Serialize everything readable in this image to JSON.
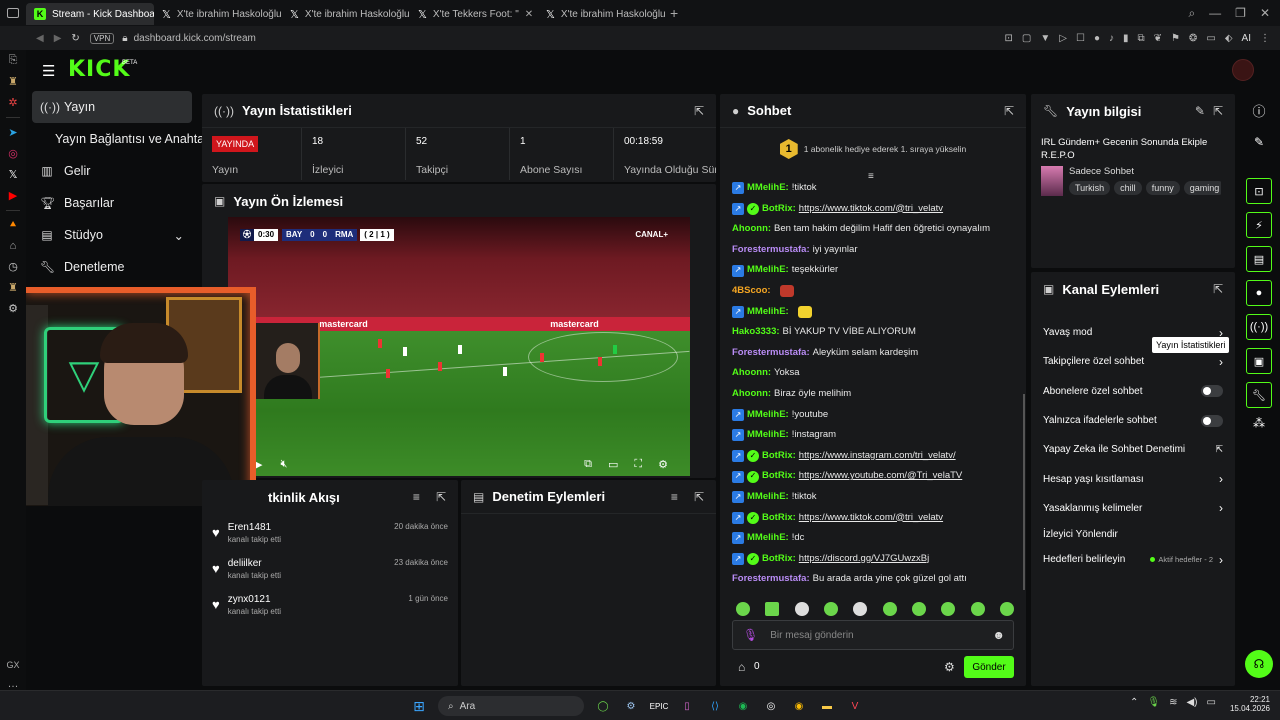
{
  "browser": {
    "tabs": [
      {
        "title": "Stream - Kick Dashboard"
      },
      {
        "title": "X'te ibrahim Haskoloğlu: \""
      },
      {
        "title": "X'te ibrahim Haskoloğlu: \""
      },
      {
        "title": "X'te Tekkers Foot: \""
      },
      {
        "title": "X'te ibrahim Haskoloğlu: \""
      }
    ],
    "vpn": "VPN",
    "url": "dashboard.kick.com/stream",
    "ai_label": "AI"
  },
  "header": {
    "logo": "KICK",
    "beta": "BETA"
  },
  "nav": {
    "items": [
      {
        "label": "Yayın",
        "icon": "live-icon"
      },
      {
        "label": "Yayın Bağlantısı ve Anahtarı",
        "icon": ""
      },
      {
        "label": "Gelir",
        "icon": "chart-icon"
      },
      {
        "label": "Başarılar",
        "icon": "trophy-icon"
      },
      {
        "label": "Stüdyo",
        "icon": "studio-icon"
      },
      {
        "label": "Denetleme",
        "icon": "wrench-icon"
      }
    ]
  },
  "stats_panel": {
    "title": "Yayın İstatistikleri",
    "live_badge": "YAYINDA",
    "stats": [
      {
        "value": "",
        "label": "Yayın"
      },
      {
        "value": "18",
        "label": "İzleyici"
      },
      {
        "value": "52",
        "label": "Takipçi"
      },
      {
        "value": "1",
        "label": "Abone Sayısı"
      },
      {
        "value": "00:18:59",
        "label": "Yayında Olduğu Süre"
      }
    ]
  },
  "preview": {
    "title": "Yayın Ön İzlemesi",
    "scoreboard": {
      "time": "0:30",
      "home": "BAY",
      "home_score": "0",
      "away_score": "0",
      "away": "RMA",
      "agg": "( 2 | 1 )"
    },
    "broadcaster": "CANAL+",
    "ad_text": "mastercard"
  },
  "activity": {
    "title": "Etkinlik Akışı",
    "title_visible": "tkinlik Akışı",
    "items": [
      {
        "name": "Eren1481",
        "action": "kanalı takip etti",
        "time": "20 dakika önce"
      },
      {
        "name": "deliilker",
        "action": "kanalı takip etti",
        "time": "23 dakika önce"
      },
      {
        "name": "zynx0121",
        "action": "kanalı takip etti",
        "time": "1 gün önce"
      }
    ]
  },
  "moderation": {
    "title": "Denetim Eylemleri"
  },
  "chat": {
    "title": "Sohbet",
    "gift_rank": "1",
    "gift_text": "1 abonelik hediye ederek 1. sıraya yükselin",
    "messages": [
      {
        "user": "MMelihE:",
        "text": "!tiktok",
        "color": "#53fc18",
        "badge": true,
        "verified": false,
        "link": false
      },
      {
        "user": "BotRix:",
        "text": "https://www.tiktok.com/@tri_velatv",
        "color": "#53fc18",
        "badge": true,
        "verified": true,
        "link": true
      },
      {
        "user": "Ahoonn:",
        "text": "Ben tam hakim değilim Hafif den öğretici oynayalım",
        "color": "#53fc18",
        "badge": false,
        "verified": false,
        "link": false
      },
      {
        "user": "Forestermustafa:",
        "text": "iyi yayınlar",
        "color": "#b98cf5",
        "badge": false,
        "verified": false,
        "link": false
      },
      {
        "user": "MMelihE:",
        "text": "teşekkürler",
        "color": "#53fc18",
        "badge": true,
        "verified": false,
        "link": false
      },
      {
        "user": "4BScoo:",
        "text": "",
        "color": "#f5a623",
        "badge": false,
        "verified": false,
        "link": false,
        "emote": "red"
      },
      {
        "user": "MMelihE:",
        "text": "",
        "color": "#53fc18",
        "badge": true,
        "verified": false,
        "link": false,
        "emote": "yellow"
      },
      {
        "user": "Hako3333:",
        "text": "Bİ YAKUP TV VİBE ALIYORUM",
        "color": "#53fc18",
        "badge": false,
        "verified": false,
        "link": false
      },
      {
        "user": "Forestermustafa:",
        "text": "Aleyküm selam kardeşim",
        "color": "#b98cf5",
        "badge": false,
        "verified": false,
        "link": false
      },
      {
        "user": "Ahoonn:",
        "text": "Yoksa",
        "color": "#53fc18",
        "badge": false,
        "verified": false,
        "link": false
      },
      {
        "user": "Ahoonn:",
        "text": "Biraz öyle melihim",
        "color": "#53fc18",
        "badge": false,
        "verified": false,
        "link": false
      },
      {
        "user": "MMelihE:",
        "text": "!youtube",
        "color": "#53fc18",
        "badge": true,
        "verified": false,
        "link": false
      },
      {
        "user": "MMelihE:",
        "text": "!instagram",
        "color": "#53fc18",
        "badge": true,
        "verified": false,
        "link": false
      },
      {
        "user": "BotRix:",
        "text": "https://www.instagram.com/tri_velatv/",
        "color": "#53fc18",
        "badge": true,
        "verified": true,
        "link": true
      },
      {
        "user": "BotRix:",
        "text": "https://www.youtube.com/@Tri_velaTV",
        "color": "#53fc18",
        "badge": true,
        "verified": true,
        "link": true
      },
      {
        "user": "MMelihE:",
        "text": "!tiktok",
        "color": "#53fc18",
        "badge": true,
        "verified": false,
        "link": false
      },
      {
        "user": "BotRix:",
        "text": "https://www.tiktok.com/@tri_velatv",
        "color": "#53fc18",
        "badge": true,
        "verified": true,
        "link": true
      },
      {
        "user": "MMelihE:",
        "text": "!dc",
        "color": "#53fc18",
        "badge": true,
        "verified": false,
        "link": false
      },
      {
        "user": "BotRix:",
        "text": "https://discord.gg/VJ7GUwzxBj",
        "color": "#53fc18",
        "badge": true,
        "verified": true,
        "link": true
      },
      {
        "user": "Forestermustafa:",
        "text": "Bu arada arda yine çok güzel gol attı",
        "color": "#b98cf5",
        "badge": false,
        "verified": false,
        "link": false
      }
    ],
    "input_placeholder": "Bir mesaj gönderin",
    "points": "0",
    "send_label": "Gönder"
  },
  "stream_info": {
    "title": "Yayın bilgisi",
    "stream_title": "IRL Gündem+ Gecenin Sonunda Ekiple R.E.P.O",
    "category": "Sadece Sohbet",
    "tags": [
      "Turkish",
      "chill",
      "funny",
      "gaming"
    ]
  },
  "channel_actions": {
    "title": "Kanal Eylemleri",
    "items": [
      {
        "label": "Yavaş mod",
        "control": "chevron"
      },
      {
        "label": "Takipçilere özel sohbet",
        "control": "chevron"
      },
      {
        "label": "Abonelere özel sohbet",
        "control": "toggle"
      },
      {
        "label": "Yalnızca ifadelerle sohbet",
        "control": "toggle"
      },
      {
        "label": "Yapay Zeka ile Sohbet Denetimi",
        "control": "external"
      },
      {
        "label": "Hesap yaşı kısıtlaması",
        "control": "chevron"
      },
      {
        "label": "Yasaklanmış kelimeler",
        "control": "chevron"
      },
      {
        "label": "İzleyici Yönlendir",
        "control": "none"
      },
      {
        "label": "Hedefleri belirleyin",
        "control": "chevron",
        "extra": "Aktif hedefler - 2"
      }
    ]
  },
  "tooltip": "Yayın İstatistikleri",
  "taskbar": {
    "search": "Ara",
    "time": "22:21",
    "date": "15.04.2026"
  },
  "colors": {
    "brand": "#53fc18",
    "live": "#d0161c",
    "panel": "#18191b",
    "bg": "#0b0c0d"
  }
}
